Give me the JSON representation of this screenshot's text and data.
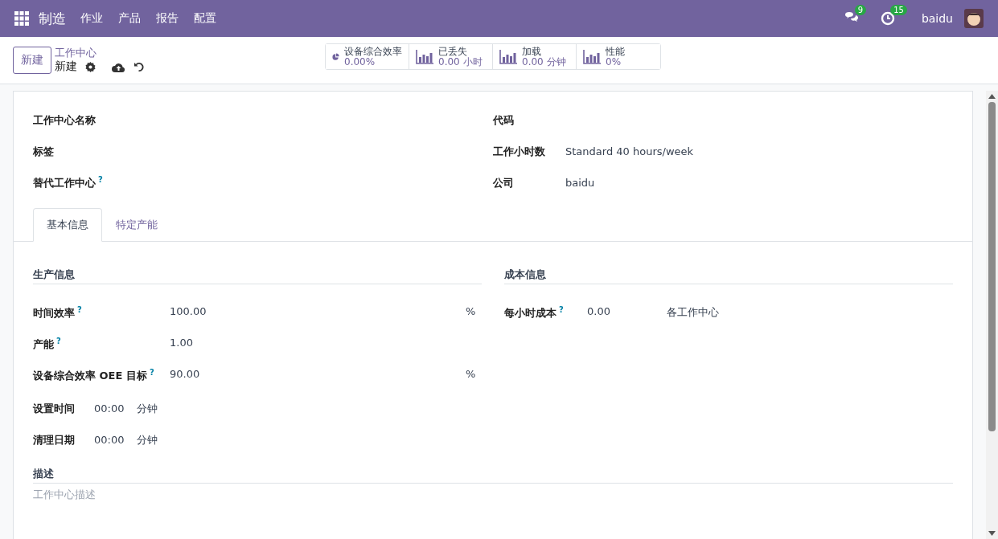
{
  "navbar": {
    "app_name": "制造",
    "menu": [
      {
        "label": "作业"
      },
      {
        "label": "产品"
      },
      {
        "label": "报告"
      },
      {
        "label": "配置"
      }
    ],
    "messages_count": "9",
    "activities_count": "15",
    "user": "baidu"
  },
  "control_panel": {
    "new_button": "新建",
    "breadcrumb": "工作中心",
    "record_name": "新建"
  },
  "stat_buttons": [
    {
      "kind": "pie",
      "label": "设备综合效率",
      "value": "0.00%"
    },
    {
      "kind": "bars",
      "label": "已丢失",
      "value": "0.00 小时"
    },
    {
      "kind": "bars",
      "label": "加载",
      "value": "0.00 分钟"
    },
    {
      "kind": "bars",
      "label": "性能",
      "value": "0%"
    }
  ],
  "header_left": [
    {
      "label": "工作中心名称"
    },
    {
      "label": "标签"
    },
    {
      "label": "替代工作中心",
      "help": "?"
    }
  ],
  "header_right": [
    {
      "label": "代码"
    },
    {
      "label": "工作小时数",
      "value": "Standard 40 hours/week"
    },
    {
      "label": "公司",
      "value": "baidu"
    }
  ],
  "tabs": [
    {
      "label": "基本信息",
      "selected": true
    },
    {
      "label": "特定产能",
      "selected": false
    }
  ],
  "production": {
    "title": "生产信息",
    "fields": [
      {
        "label": "时间效率",
        "help": "?",
        "value": "100.00",
        "unit": "%"
      },
      {
        "label": "产能",
        "help": "?",
        "value": "1.00"
      },
      {
        "label": "设备综合效率 OEE 目标",
        "help": "?",
        "value": "90.00",
        "unit": "%"
      }
    ],
    "inline_fields": [
      {
        "label": "设置时间",
        "value": "00:00",
        "unit": "分钟"
      },
      {
        "label": "清理日期",
        "value": "00:00",
        "unit": "分钟"
      }
    ]
  },
  "cost": {
    "title": "成本信息",
    "fields": [
      {
        "label": "每小时成本",
        "help": "?",
        "value": "0.00",
        "unit": "各工作中心"
      }
    ]
  },
  "description": {
    "title": "描述",
    "placeholder": "工作中心描述"
  }
}
